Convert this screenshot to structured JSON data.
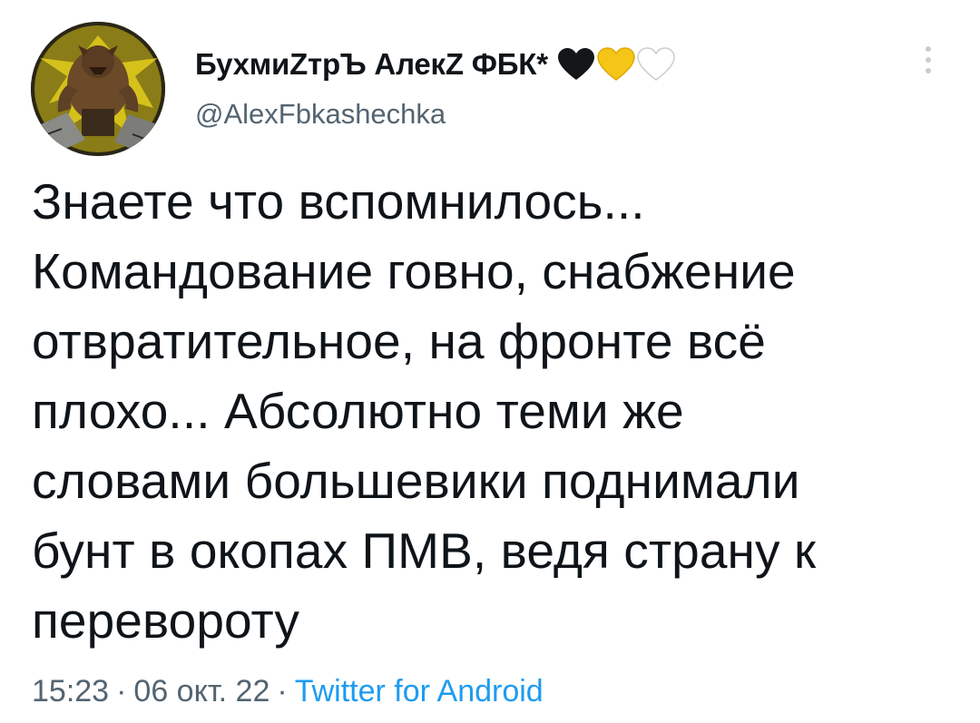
{
  "author": {
    "display_name": "БухмиZтрЪ АлекZ ФБК*",
    "username": "@AlexFbkashechka",
    "heart_icons": [
      "black-heart-icon",
      "yellow-heart-icon",
      "white-heart-icon"
    ]
  },
  "tweet": {
    "text": "Знаете что вспомнилось...\nКомандование говно, снабжение\nотвратительное, на фронте всё\nплохо... Абсолютно теми же\nсловами большевики поднимали\nбунт в окопах ПМВ, ведя страну к\nперевороту",
    "time": "15:23",
    "date": "06 окт. 22",
    "separator": "·",
    "source": "Twitter for Android"
  },
  "colors": {
    "text": "#0f1419",
    "secondary": "#536471",
    "link": "#1d9bf0",
    "heart_black": "#14171a",
    "heart_yellow": "#f5c518",
    "heart_white": "#ffffff"
  }
}
